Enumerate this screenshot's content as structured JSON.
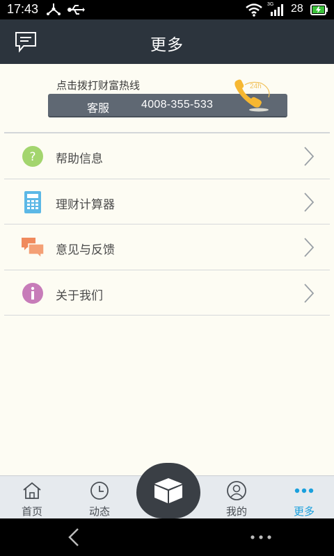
{
  "status_bar": {
    "time": "17:43",
    "battery_level": "28",
    "network_type": "3G",
    "icons": [
      "fork-icon",
      "usb-icon",
      "wifi-icon",
      "signal-icon",
      "battery-charging-icon"
    ]
  },
  "header": {
    "title": "更多",
    "left_icon": "message-icon"
  },
  "hotline": {
    "label": "点击拨打财富热线",
    "service_label": "客服",
    "phone_number": "4008-355-533",
    "badge_text": "24h"
  },
  "menu": {
    "items": [
      {
        "label": "帮助信息",
        "icon": "help-icon",
        "color": "#a3d56e"
      },
      {
        "label": "理财计算器",
        "icon": "calculator-icon",
        "color": "#5cb8e6"
      },
      {
        "label": "意见与反馈",
        "icon": "feedback-icon",
        "color": "#f08a5d"
      },
      {
        "label": "关于我们",
        "icon": "info-icon",
        "color": "#c77cb9"
      }
    ]
  },
  "tabbar": {
    "tabs": [
      {
        "label": "首页",
        "icon": "home-icon"
      },
      {
        "label": "动态",
        "icon": "clock-icon"
      },
      {
        "label": "",
        "icon": "box-icon"
      },
      {
        "label": "我的",
        "icon": "user-icon"
      },
      {
        "label": "更多",
        "icon": "more-icon",
        "active": true
      }
    ],
    "active_color": "#1aa0dd"
  },
  "colors": {
    "header_bg": "#2c343d",
    "page_bg": "#fdfcf3",
    "hotline_bar": "#5f6873"
  }
}
